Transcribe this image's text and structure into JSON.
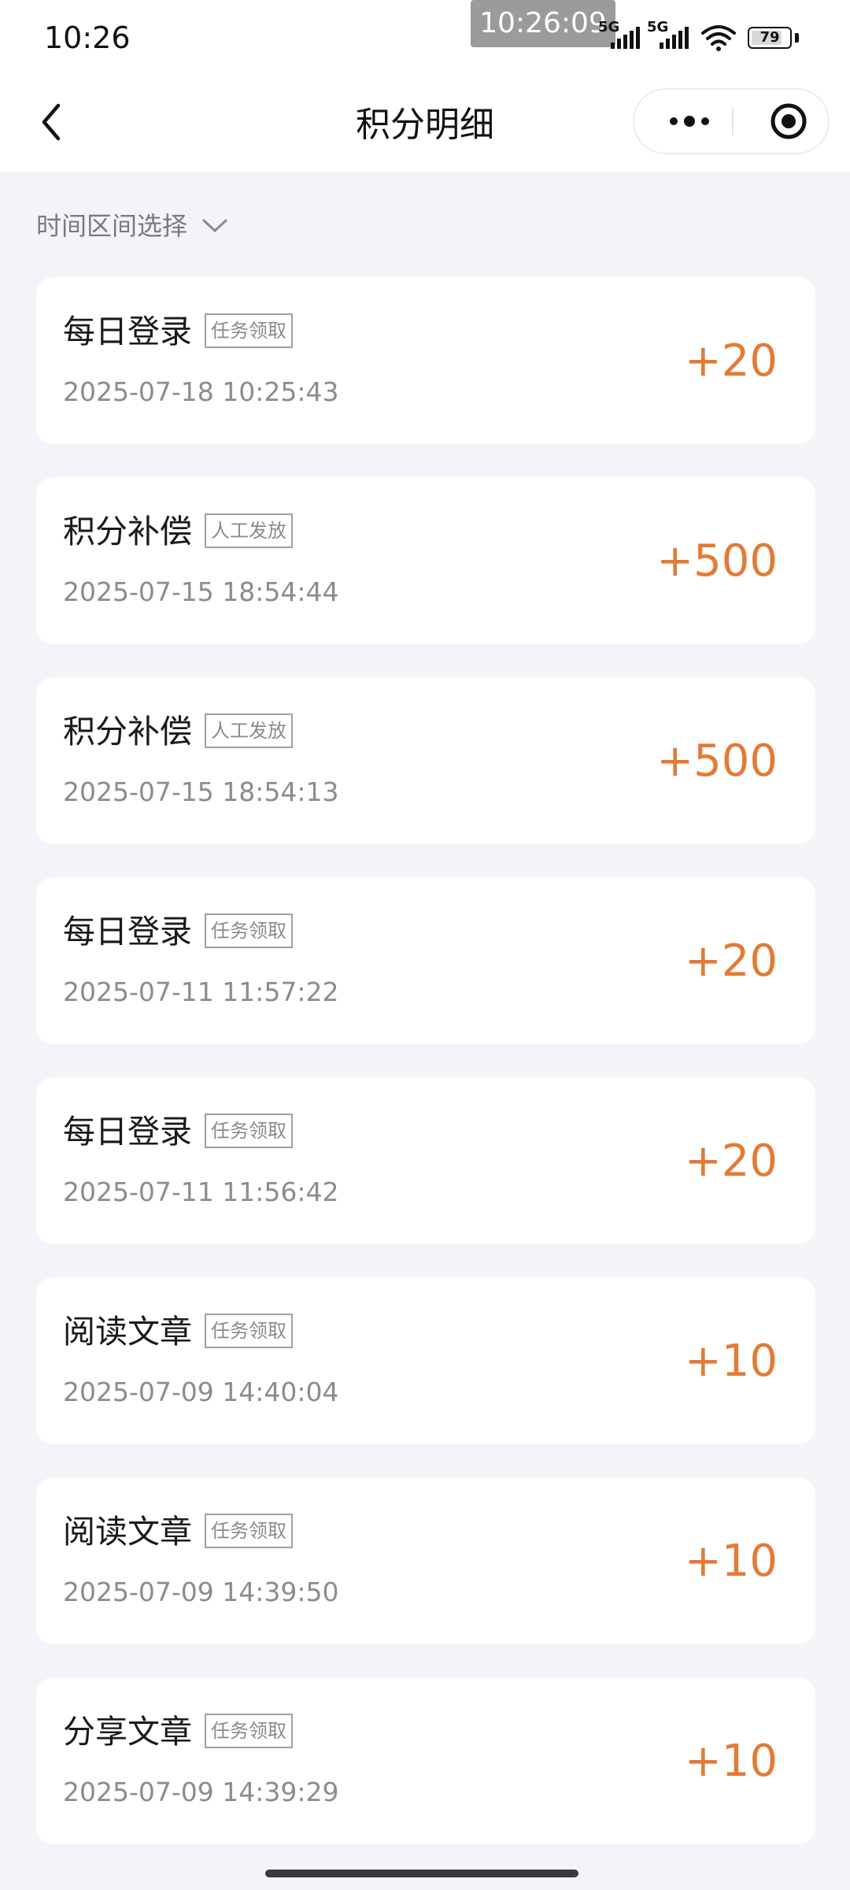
{
  "status_bar": {
    "time": "10:26",
    "overlay_time": "10:26:09",
    "signal_1_label": "5G",
    "signal_2_label": "5G",
    "battery": "79"
  },
  "nav": {
    "title": "积分明细",
    "back_icon": "chevron-left-icon",
    "more_icon": "more-dots-icon",
    "close_icon": "target-circle-icon"
  },
  "filter": {
    "label": "时间区间选择",
    "icon": "chevron-down-icon"
  },
  "records": [
    {
      "title": "每日登录",
      "tag": "任务领取",
      "time": "2025-07-18 10:25:43",
      "points": "+20"
    },
    {
      "title": "积分补偿",
      "tag": "人工发放",
      "time": "2025-07-15 18:54:44",
      "points": "+500"
    },
    {
      "title": "积分补偿",
      "tag": "人工发放",
      "time": "2025-07-15 18:54:13",
      "points": "+500"
    },
    {
      "title": "每日登录",
      "tag": "任务领取",
      "time": "2025-07-11 11:57:22",
      "points": "+20"
    },
    {
      "title": "每日登录",
      "tag": "任务领取",
      "time": "2025-07-11 11:56:42",
      "points": "+20"
    },
    {
      "title": "阅读文章",
      "tag": "任务领取",
      "time": "2025-07-09 14:40:04",
      "points": "+10"
    },
    {
      "title": "阅读文章",
      "tag": "任务领取",
      "time": "2025-07-09 14:39:50",
      "points": "+10"
    },
    {
      "title": "分享文章",
      "tag": "任务领取",
      "time": "2025-07-09 14:39:29",
      "points": "+10"
    }
  ],
  "colors": {
    "accent": "#e37b35",
    "background": "#f4f4f8",
    "card": "#ffffff"
  }
}
